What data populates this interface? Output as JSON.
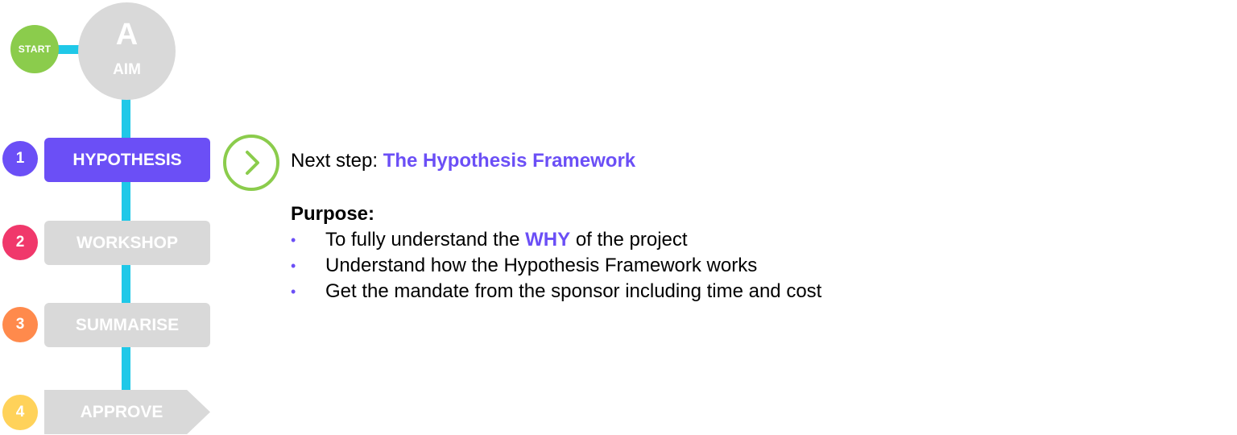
{
  "colors": {
    "accent": "#6b4ff6",
    "connector": "#1fc8e8",
    "start": "#8bcc4c",
    "inactive": "#d9d9d9",
    "step1": "#6b4ff6",
    "step2": "#f0386b",
    "step3": "#ff8a4c",
    "step4": "#ffd25a"
  },
  "start": {
    "label": "START"
  },
  "aim": {
    "letter": "A",
    "label": "AIM"
  },
  "steps": [
    {
      "number": "1",
      "label": "HYPOTHESIS",
      "state": "active"
    },
    {
      "number": "2",
      "label": "WORKSHOP",
      "state": "inactive"
    },
    {
      "number": "3",
      "label": "SUMMARISE",
      "state": "inactive"
    },
    {
      "number": "4",
      "label": "APPROVE",
      "state": "inactive"
    }
  ],
  "next_icon": "chevron-right-icon",
  "next_step": {
    "prefix": "Next step: ",
    "highlight": "The Hypothesis Framework"
  },
  "purpose": {
    "heading": "Purpose:",
    "bullet_glyph": "•",
    "items": [
      {
        "before": "To fully understand the ",
        "highlight": "WHY",
        "after": " of the project"
      },
      {
        "before": "Understand how the Hypothesis Framework works",
        "highlight": "",
        "after": ""
      },
      {
        "before": "Get the mandate from the sponsor including time and cost",
        "highlight": "",
        "after": ""
      }
    ]
  }
}
